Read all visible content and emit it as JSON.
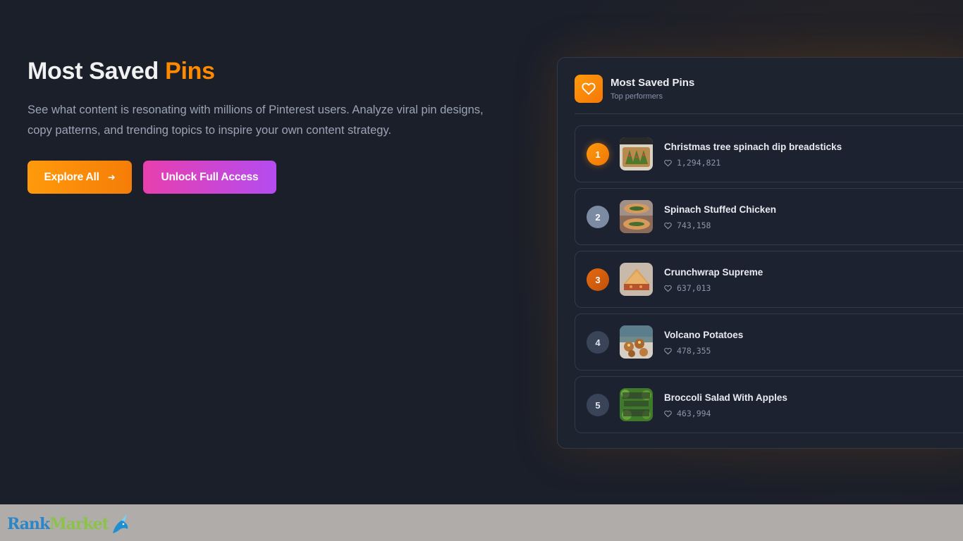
{
  "hero": {
    "title_main": "Most Saved ",
    "title_accent": "Pins",
    "description": "See what content is resonating with millions of Pinterest users. Analyze viral pin designs, copy patterns, and trending topics to inspire your own content strategy.",
    "explore_label": "Explore All",
    "explore_icon": "arrow-right-icon",
    "unlock_label": "Unlock Full Access"
  },
  "panel": {
    "title": "Most Saved Pins",
    "subtitle": "Top performers",
    "icon": "heart-icon"
  },
  "pins": [
    {
      "rank": "1",
      "title": "Christmas tree spinach dip breadsticks",
      "saves": "1,294,821"
    },
    {
      "rank": "2",
      "title": "Spinach Stuffed Chicken",
      "saves": "743,158"
    },
    {
      "rank": "3",
      "title": "Crunchwrap Supreme",
      "saves": "637,013"
    },
    {
      "rank": "4",
      "title": "Volcano Potatoes",
      "saves": "478,355"
    },
    {
      "rank": "5",
      "title": "Broccoli Salad With Apples",
      "saves": "463,994"
    }
  ],
  "footer": {
    "logo_rank": "Rank",
    "logo_market": "Market"
  },
  "colors": {
    "accent": "#ff8a00",
    "background": "#1b1f2a",
    "unlock_gradient_start": "#e83fae",
    "unlock_gradient_end": "#b44cf0"
  }
}
